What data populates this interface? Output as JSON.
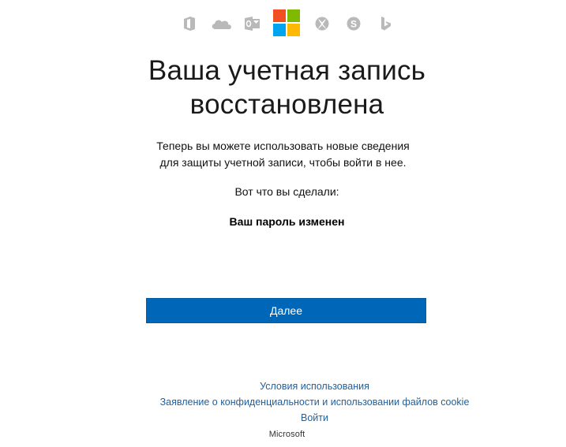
{
  "brand_bar": {
    "icons": [
      "office-icon",
      "onedrive-icon",
      "outlook-icon",
      "microsoft-logo-icon",
      "xbox-icon",
      "skype-icon",
      "bing-icon"
    ],
    "logo_colors": {
      "red": "#f25022",
      "green": "#7fba00",
      "blue": "#00a4ef",
      "yellow": "#ffb900"
    },
    "icon_color": "#b9b9b9"
  },
  "main": {
    "title_line1": "Ваша учетная запись",
    "title_line2": "восстановлена",
    "description_line1": "Теперь вы можете использовать новые сведения",
    "description_line2": "для защиты учетной записи, чтобы войти в нее.",
    "done_label": "Вот что вы сделали:",
    "done_item": "Ваш пароль изменен",
    "next_button_label": "Далее"
  },
  "footer": {
    "terms_link": "Условия использования",
    "privacy_link": "Заявление о конфиденциальности и использовании файлов cookie",
    "sign_in_link": "Войти",
    "brand_text": "Microsoft"
  },
  "colors": {
    "button": "#0067b8",
    "link": "#1f5f9e"
  }
}
